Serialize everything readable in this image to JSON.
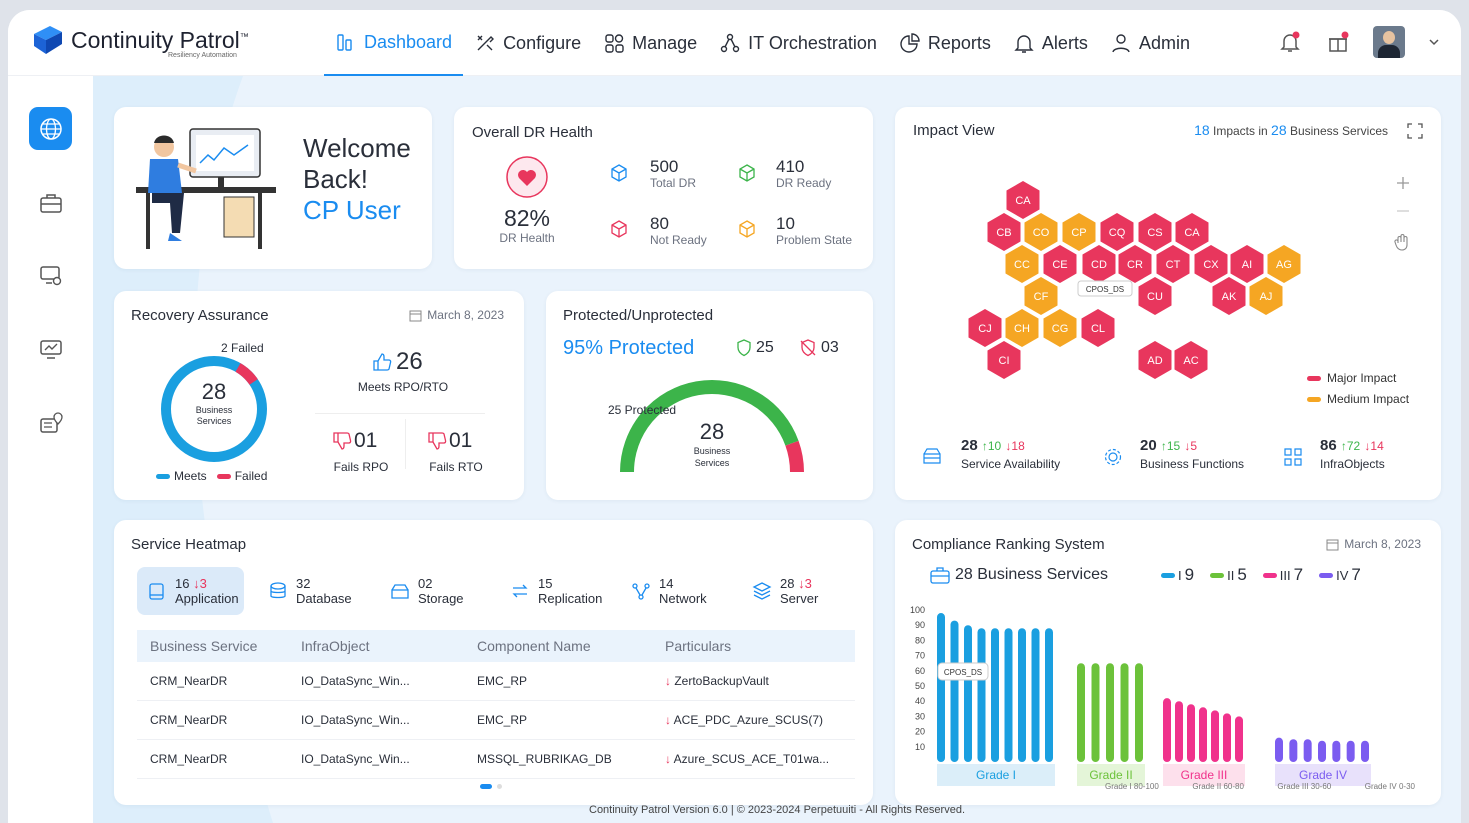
{
  "brand": {
    "name": "Continuity Patrol",
    "tm": "™",
    "tagline": "Resiliency Automation"
  },
  "nav": [
    {
      "label": "Dashboard",
      "icon": "dashboard-icon"
    },
    {
      "label": "Configure",
      "icon": "tools-icon"
    },
    {
      "label": "Manage",
      "icon": "grid-icon"
    },
    {
      "label": "IT Orchestration",
      "icon": "orchestration-icon"
    },
    {
      "label": "Reports",
      "icon": "pie-chart-icon"
    },
    {
      "label": "Alerts",
      "icon": "bell-icon"
    },
    {
      "label": "Admin",
      "icon": "user-icon"
    }
  ],
  "welcome": {
    "line1": "Welcome",
    "line2": "Back!",
    "user": "CP User"
  },
  "dr_health": {
    "title": "Overall DR Health",
    "percent": "82%",
    "label": "DR Health",
    "total_dr": "500",
    "total_dr_label": "Total DR",
    "dr_ready": "410",
    "dr_ready_label": "DR Ready",
    "not_ready": "80",
    "not_ready_label": "Not Ready",
    "problem": "10",
    "problem_label": "Problem State"
  },
  "impact": {
    "title": "Impact View",
    "count": "18",
    "mid": "Impacts in",
    "services": "28",
    "tail": "Business Services",
    "tooltip": "CPOS_DS",
    "legend_major": "Major Impact",
    "legend_medium": "Medium Impact",
    "colors": {
      "major": "#e8365d",
      "medium": "#f5a623"
    },
    "hexes": [
      {
        "t": "CA",
        "c": "r"
      },
      {
        "t": "CB",
        "c": "r"
      },
      {
        "t": "CO",
        "c": "o"
      },
      {
        "t": "CP",
        "c": "o"
      },
      {
        "t": "CQ",
        "c": "r"
      },
      {
        "t": "CS",
        "c": "r"
      },
      {
        "t": "CA",
        "c": "r"
      },
      {
        "t": "CC",
        "c": "o"
      },
      {
        "t": "CE",
        "c": "r"
      },
      {
        "t": "CD",
        "c": "r"
      },
      {
        "t": "CR",
        "c": "r"
      },
      {
        "t": "CT",
        "c": "r"
      },
      {
        "t": "CX",
        "c": "r"
      },
      {
        "t": "AI",
        "c": "r"
      },
      {
        "t": "AG",
        "c": "o"
      },
      {
        "t": "CF",
        "c": "o"
      },
      {
        "t": "CU",
        "c": "r"
      },
      {
        "t": "AK",
        "c": "r"
      },
      {
        "t": "AJ",
        "c": "o"
      },
      {
        "t": "CJ",
        "c": "r"
      },
      {
        "t": "CH",
        "c": "o"
      },
      {
        "t": "CG",
        "c": "o"
      },
      {
        "t": "CL",
        "c": "r"
      },
      {
        "t": "CI",
        "c": "r"
      },
      {
        "t": "AD",
        "c": "r"
      },
      {
        "t": "AC",
        "c": "r"
      }
    ],
    "stats": [
      {
        "value": "28",
        "up": "↑10",
        "down": "↓18",
        "label": "Service Availability"
      },
      {
        "value": "20",
        "up": "↑15",
        "down": "↓5",
        "label": "Business Functions"
      },
      {
        "value": "86",
        "up": "↑72",
        "down": "↓14",
        "label": "InfraObjects"
      }
    ]
  },
  "recovery": {
    "title": "Recovery Assurance",
    "date": "March 8, 2023",
    "failed_note": "2 Failed",
    "total": "28",
    "sub1": "Business",
    "sub2": "Services",
    "meets": "26",
    "meets_label": "Meets RPO/RTO",
    "fails_rpo": "01",
    "fails_rpo_label": "Fails RPO",
    "fails_rto": "01",
    "fails_rto_label": "Fails RTO",
    "legend_meets": "Meets",
    "legend_failed": "Failed",
    "meets_value": 26,
    "failed_value": 2
  },
  "protected": {
    "title": "Protected/Unprotected",
    "headline": "95% Protected",
    "protected_count": "25",
    "unprotected_count": "03",
    "gauge_label": "25 Protected",
    "total": "28",
    "sub1": "Business",
    "sub2": "Services",
    "protected_fraction": 0.89
  },
  "heatmap": {
    "title": "Service Heatmap",
    "tabs": [
      {
        "count": "16",
        "down": "↓3",
        "label": "Application",
        "icon": "application-icon"
      },
      {
        "count": "32",
        "down": "",
        "label": "Database",
        "icon": "database-icon"
      },
      {
        "count": "02",
        "down": "",
        "label": "Storage",
        "icon": "storage-icon"
      },
      {
        "count": "15",
        "down": "",
        "label": "Replication",
        "icon": "replication-icon"
      },
      {
        "count": "14",
        "down": "",
        "label": "Network",
        "icon": "network-icon"
      },
      {
        "count": "28",
        "down": "↓3",
        "label": "Server",
        "icon": "server-icon"
      }
    ],
    "columns": [
      "Business Service",
      "InfraObject",
      "Component Name",
      "Particulars"
    ],
    "rows": [
      [
        "CRM_NearDR",
        "IO_DataSync_Win...",
        "EMC_RP",
        "ZertoBackupVault"
      ],
      [
        "CRM_NearDR",
        "IO_DataSync_Win...",
        "EMC_RP",
        "ACE_PDC_Azure_SCUS(7)"
      ],
      [
        "CRM_NearDR",
        "IO_DataSync_Win...",
        "MSSQL_RUBRIKAG_DB",
        "Azure_SCUS_ACE_T01wa..."
      ]
    ]
  },
  "compliance": {
    "title": "Compliance Ranking System",
    "date": "March 8, 2023",
    "bs": "28 Business Services",
    "legend": [
      {
        "label": "I",
        "value": "9",
        "color": "#1a9fe0"
      },
      {
        "label": "II",
        "value": "5",
        "color": "#6cc23a"
      },
      {
        "label": "III",
        "value": "7",
        "color": "#f0328c"
      },
      {
        "label": "IV",
        "value": "7",
        "color": "#7b5cf0"
      }
    ],
    "tooltip": "CPOS_DS",
    "footnotes": [
      "Grade I 80-100",
      "Grade II 60-80",
      "Grade III 30-60",
      "Grade IV 0-30"
    ]
  },
  "chart_data": {
    "type": "bar",
    "ylim": [
      0,
      100
    ],
    "yticks": [
      100,
      90,
      80,
      70,
      60,
      50,
      40,
      30,
      20,
      10
    ],
    "categories": [
      "Grade I",
      "Grade II",
      "Grade III",
      "Grade IV"
    ],
    "series": [
      {
        "name": "I",
        "values": [
          98,
          93,
          90,
          88,
          88,
          88,
          88,
          88,
          88
        ]
      },
      {
        "name": "II",
        "values": [
          65,
          65,
          65,
          65,
          65
        ]
      },
      {
        "name": "III",
        "values": [
          42,
          40,
          38,
          36,
          34,
          32,
          30
        ]
      },
      {
        "name": "IV",
        "values": [
          16,
          15,
          15,
          14,
          14,
          14,
          14
        ]
      }
    ],
    "band_colors": [
      "#dbeef9",
      "#e4f5d8",
      "#fde0ec",
      "#e8e1fb"
    ]
  },
  "footer": "Continuity Patrol Version 6.0 | © 2023-2024 Perpetuuiti - All Rights Reserved."
}
